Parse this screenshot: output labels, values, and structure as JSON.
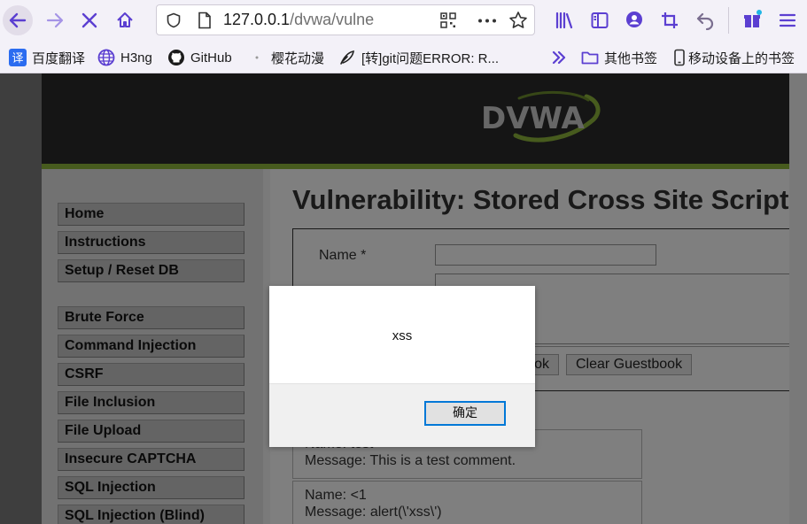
{
  "browser": {
    "url_host": "127.0.0.1",
    "url_path": "/dvwa/vulnerabilities/xss_s/",
    "bookmarks": [
      {
        "label": "百度翻译",
        "icon": "translate-icon"
      },
      {
        "label": "H3ng",
        "icon": "globe-icon"
      },
      {
        "label": "GitHub",
        "icon": "github-icon"
      },
      {
        "label": "樱花动漫",
        "icon": "dot-icon"
      },
      {
        "label": "[转]git问题ERROR: R...",
        "icon": "feather-icon"
      },
      {
        "label": "其他书签",
        "icon": "folder-icon"
      },
      {
        "label": "移动设备上的书签",
        "icon": "mobile-icon"
      }
    ],
    "colors": {
      "accent": "#5b3fd1",
      "toolbar": "#f3f1f8"
    }
  },
  "dvwa": {
    "logo": "DVWA",
    "title": "Vulnerability: Stored Cross Site Scripting (XSS)",
    "menu": [
      "Home",
      "Instructions",
      "Setup / Reset DB",
      "Brute Force",
      "Command Injection",
      "CSRF",
      "File Inclusion",
      "File Upload",
      "Insecure CAPTCHA",
      "SQL Injection",
      "SQL Injection (Blind)"
    ],
    "form": {
      "name_label": "Name *",
      "sign_button": "Sign Guestbook",
      "sign_button_visible": "ok",
      "clear_button": "Clear Guestbook"
    },
    "comments": [
      {
        "name": "Name: test",
        "message": "Message: This is a test comment."
      },
      {
        "name": "Name: <1",
        "message": "Message: alert(\\'xss\\')"
      }
    ],
    "colors": {
      "header": "#2a2a2a",
      "accent_bar": "#8fb63c"
    }
  },
  "alert": {
    "message": "xss",
    "ok_label": "确定"
  }
}
